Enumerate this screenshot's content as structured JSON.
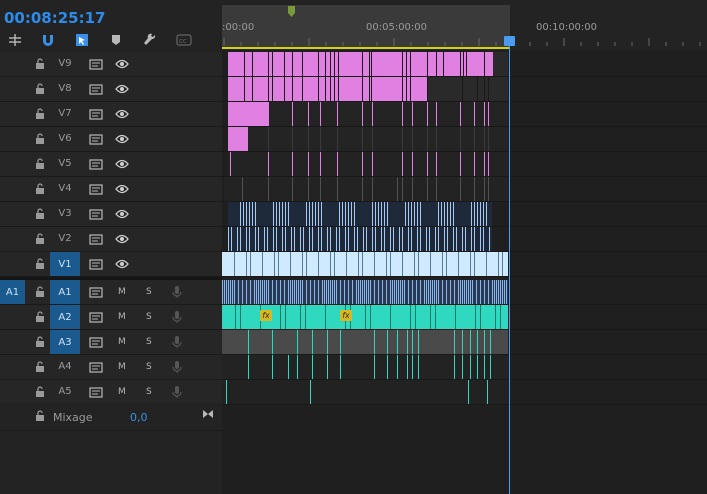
{
  "timecode": "00:08:25:17",
  "ruler": {
    "ticks": [
      ":00:00",
      "00:05:00:00",
      "00:10:00:00"
    ]
  },
  "toolbar": [
    "snap-insert-icon",
    "magnet-icon",
    "linked-selection-icon",
    "marker-icon",
    "wrench-icon",
    "captions-icon"
  ],
  "video_tracks": [
    {
      "name": "V9",
      "targeted": false
    },
    {
      "name": "V8",
      "targeted": false
    },
    {
      "name": "V7",
      "targeted": false
    },
    {
      "name": "V6",
      "targeted": false
    },
    {
      "name": "V5",
      "targeted": false
    },
    {
      "name": "V4",
      "targeted": false
    },
    {
      "name": "V3",
      "targeted": false
    },
    {
      "name": "V2",
      "targeted": false
    },
    {
      "name": "V1",
      "targeted": true
    }
  ],
  "audio_tracks": [
    {
      "name": "A1",
      "source": "A1",
      "targeted": true,
      "m": "M",
      "s": "S"
    },
    {
      "name": "A2",
      "source": "",
      "targeted": true,
      "m": "M",
      "s": "S"
    },
    {
      "name": "A3",
      "source": "",
      "targeted": true,
      "m": "M",
      "s": "S"
    },
    {
      "name": "A4",
      "source": "",
      "targeted": false,
      "m": "M",
      "s": "S"
    },
    {
      "name": "A5",
      "source": "",
      "targeted": false,
      "m": "M",
      "s": "S"
    }
  ],
  "mix": {
    "label": "Mixage",
    "value": "0,0"
  },
  "fx_badge": "fx",
  "colors": {
    "timecode": "#2d8ceb",
    "pink_clip": "#e080e0",
    "blue_clip": "#a6c8f0",
    "v1_clip": "#cfeaff",
    "teal_audio": "#2fd9c0",
    "a1_audio": "#88b5e8",
    "playhead": "#4b9bf0",
    "work_bar": "#d4d400"
  }
}
